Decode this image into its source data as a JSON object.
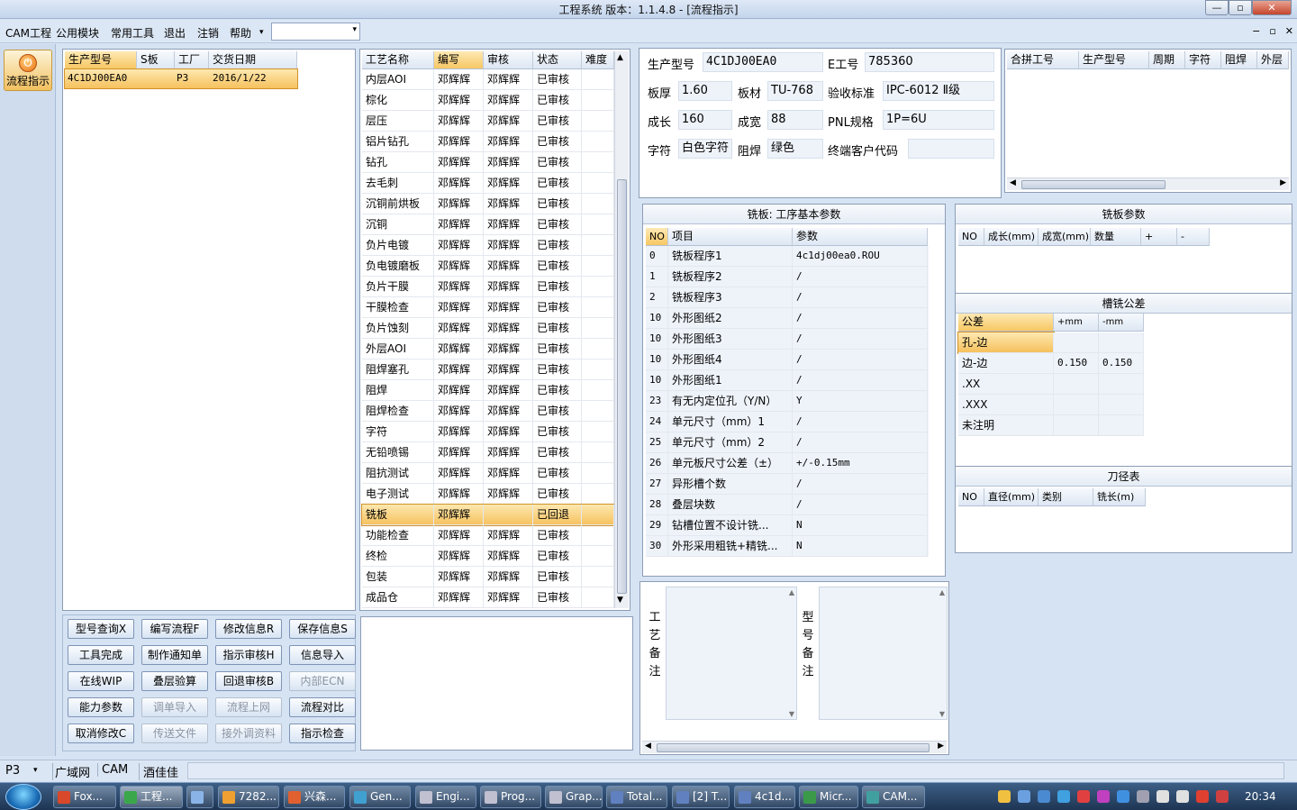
{
  "window": {
    "title": "工程系统   版本：1.1.4.8 - [流程指示]",
    "min": "—",
    "max": "▫",
    "close": "✕"
  },
  "menu": {
    "items": [
      "CAM工程",
      "公用模块",
      "常用工具",
      "退出",
      "注销",
      "帮助"
    ],
    "help_arrow": "▾",
    "combo_value": "",
    "combo_arrow": "▾",
    "mdi": [
      "−",
      "▫",
      "✕"
    ]
  },
  "sidebar": {
    "flow_label": "流程指示"
  },
  "orders": {
    "headers": [
      "生产型号",
      "S板",
      "工厂",
      "交货日期"
    ],
    "rows": [
      [
        "4C1DJ00EA0",
        "",
        "P3",
        "2016/1/22"
      ]
    ]
  },
  "process": {
    "headers": [
      "工艺名称",
      "编写",
      "审核",
      "状态",
      "难度"
    ],
    "rows": [
      [
        "内层AOI",
        "邓辉辉",
        "邓辉辉",
        "已审核",
        ""
      ],
      [
        "棕化",
        "邓辉辉",
        "邓辉辉",
        "已审核",
        ""
      ],
      [
        "层压",
        "邓辉辉",
        "邓辉辉",
        "已审核",
        ""
      ],
      [
        "铝片钻孔",
        "邓辉辉",
        "邓辉辉",
        "已审核",
        ""
      ],
      [
        "钻孔",
        "邓辉辉",
        "邓辉辉",
        "已审核",
        ""
      ],
      [
        "去毛刺",
        "邓辉辉",
        "邓辉辉",
        "已审核",
        ""
      ],
      [
        "沉铜前烘板",
        "邓辉辉",
        "邓辉辉",
        "已审核",
        ""
      ],
      [
        "沉铜",
        "邓辉辉",
        "邓辉辉",
        "已审核",
        ""
      ],
      [
        "负片电镀",
        "邓辉辉",
        "邓辉辉",
        "已审核",
        ""
      ],
      [
        "负电镀磨板",
        "邓辉辉",
        "邓辉辉",
        "已审核",
        ""
      ],
      [
        "负片干膜",
        "邓辉辉",
        "邓辉辉",
        "已审核",
        ""
      ],
      [
        "干膜检查",
        "邓辉辉",
        "邓辉辉",
        "已审核",
        ""
      ],
      [
        "负片蚀刻",
        "邓辉辉",
        "邓辉辉",
        "已审核",
        ""
      ],
      [
        "外层AOI",
        "邓辉辉",
        "邓辉辉",
        "已审核",
        ""
      ],
      [
        "阻焊塞孔",
        "邓辉辉",
        "邓辉辉",
        "已审核",
        ""
      ],
      [
        "阻焊",
        "邓辉辉",
        "邓辉辉",
        "已审核",
        ""
      ],
      [
        "阻焊检查",
        "邓辉辉",
        "邓辉辉",
        "已审核",
        ""
      ],
      [
        "字符",
        "邓辉辉",
        "邓辉辉",
        "已审核",
        ""
      ],
      [
        "无铅喷锡",
        "邓辉辉",
        "邓辉辉",
        "已审核",
        ""
      ],
      [
        "阻抗测试",
        "邓辉辉",
        "邓辉辉",
        "已审核",
        ""
      ],
      [
        "电子测试",
        "邓辉辉",
        "邓辉辉",
        "已审核",
        ""
      ],
      [
        "铣板",
        "邓辉辉",
        "",
        "已回退",
        ""
      ],
      [
        "功能检查",
        "邓辉辉",
        "邓辉辉",
        "已审核",
        ""
      ],
      [
        "终检",
        "邓辉辉",
        "邓辉辉",
        "已审核",
        ""
      ],
      [
        "包装",
        "邓辉辉",
        "邓辉辉",
        "已审核",
        ""
      ],
      [
        "成品仓",
        "邓辉辉",
        "邓辉辉",
        "已审核",
        ""
      ]
    ]
  },
  "buttons": [
    [
      "型号查询X",
      "编写流程F",
      "修改信息R",
      "保存信息S"
    ],
    [
      "工具完成",
      "制作通知单",
      "指示审核H",
      "信息导入"
    ],
    [
      "在线WIP",
      "叠层验算",
      "回退审核B",
      "内部ECN"
    ],
    [
      "能力参数",
      "调单导入",
      "流程上网",
      "流程对比"
    ],
    [
      "取消修改C",
      "传送文件",
      "接外调资料",
      "指示检查"
    ]
  ],
  "info": {
    "model_label": "生产型号",
    "model": "4C1DJ00EA0",
    "eno_label": "E工号",
    "eno": "785360",
    "thick_label": "板厚",
    "thick": "1.60",
    "mat_label": "板材",
    "mat": "TU-768",
    "std_label": "验收标准",
    "std": "IPC-6012 Ⅱ级",
    "len_label": "成长",
    "len": "160",
    "wid_label": "成宽",
    "wid": "88",
    "pnl_label": "PNL规格",
    "pnl": "1P=6U",
    "char_label": "字符",
    "char": "白色字符",
    "mask_label": "阻焊",
    "mask": "绿色",
    "cust_label": "终端客户代码",
    "cust": ""
  },
  "merge": {
    "headers": [
      "合拼工号",
      "生产型号",
      "周期",
      "字符",
      "阻焊",
      "外层"
    ]
  },
  "routing": {
    "title": "铣板: 工序基本参数",
    "headers": [
      "NO",
      "项目",
      "参数"
    ],
    "rows": [
      [
        "0",
        "铣板程序1",
        "4c1dj00ea0.ROU"
      ],
      [
        "1",
        "铣板程序2",
        "/"
      ],
      [
        "2",
        "铣板程序3",
        "/"
      ],
      [
        "10",
        "外形图纸2",
        "/"
      ],
      [
        "10",
        "外形图纸3",
        "/"
      ],
      [
        "10",
        "外形图纸4",
        "/"
      ],
      [
        "10",
        "外形图纸1",
        "/"
      ],
      [
        "23",
        "有无内定位孔（Y/N）",
        "Y"
      ],
      [
        "24",
        "单元尺寸（mm）1",
        "/"
      ],
      [
        "25",
        "单元尺寸（mm）2",
        "/"
      ],
      [
        "26",
        "单元板尺寸公差（±）",
        "+/-0.15mm"
      ],
      [
        "27",
        "异形槽个数",
        "/"
      ],
      [
        "28",
        "叠层块数",
        "/"
      ],
      [
        "29",
        "钻槽位置不设计铣...",
        "N"
      ],
      [
        "30",
        "外形采用粗铣+精铣...",
        "N"
      ]
    ]
  },
  "mill_params": {
    "title": "铣板参数",
    "headers": [
      "NO",
      "成长(mm)",
      "成宽(mm)",
      "数量",
      "+",
      "-"
    ]
  },
  "slot_tol": {
    "title": "槽铣公差",
    "headers": [
      "公差",
      "+mm",
      "-mm"
    ],
    "rows": [
      [
        "孔-边",
        "",
        ""
      ],
      [
        "边-边",
        "0.150",
        "0.150"
      ],
      [
        ".XX",
        "",
        ""
      ],
      [
        ".XXX",
        "",
        ""
      ],
      [
        "未注明",
        "",
        ""
      ]
    ]
  },
  "tools": {
    "title": "刀径表",
    "headers": [
      "NO",
      "直径(mm)",
      "类别",
      "铣长(m)"
    ]
  },
  "notes": {
    "process_label": "工艺备注",
    "model_label": "型号备注"
  },
  "status": {
    "factory": "P3",
    "arrow": "▾",
    "items": [
      "广域网",
      "CAM",
      "酒佳佳"
    ]
  },
  "taskbar": {
    "tasks": [
      "Fox...",
      "工程...",
      "",
      "7282...",
      "兴森...",
      "Gen...",
      "Engi...",
      "Prog...",
      "Grap...",
      "Total...",
      "[2] T...",
      "4c1d...",
      "Micr...",
      "CAM..."
    ],
    "clock": "20:34"
  }
}
